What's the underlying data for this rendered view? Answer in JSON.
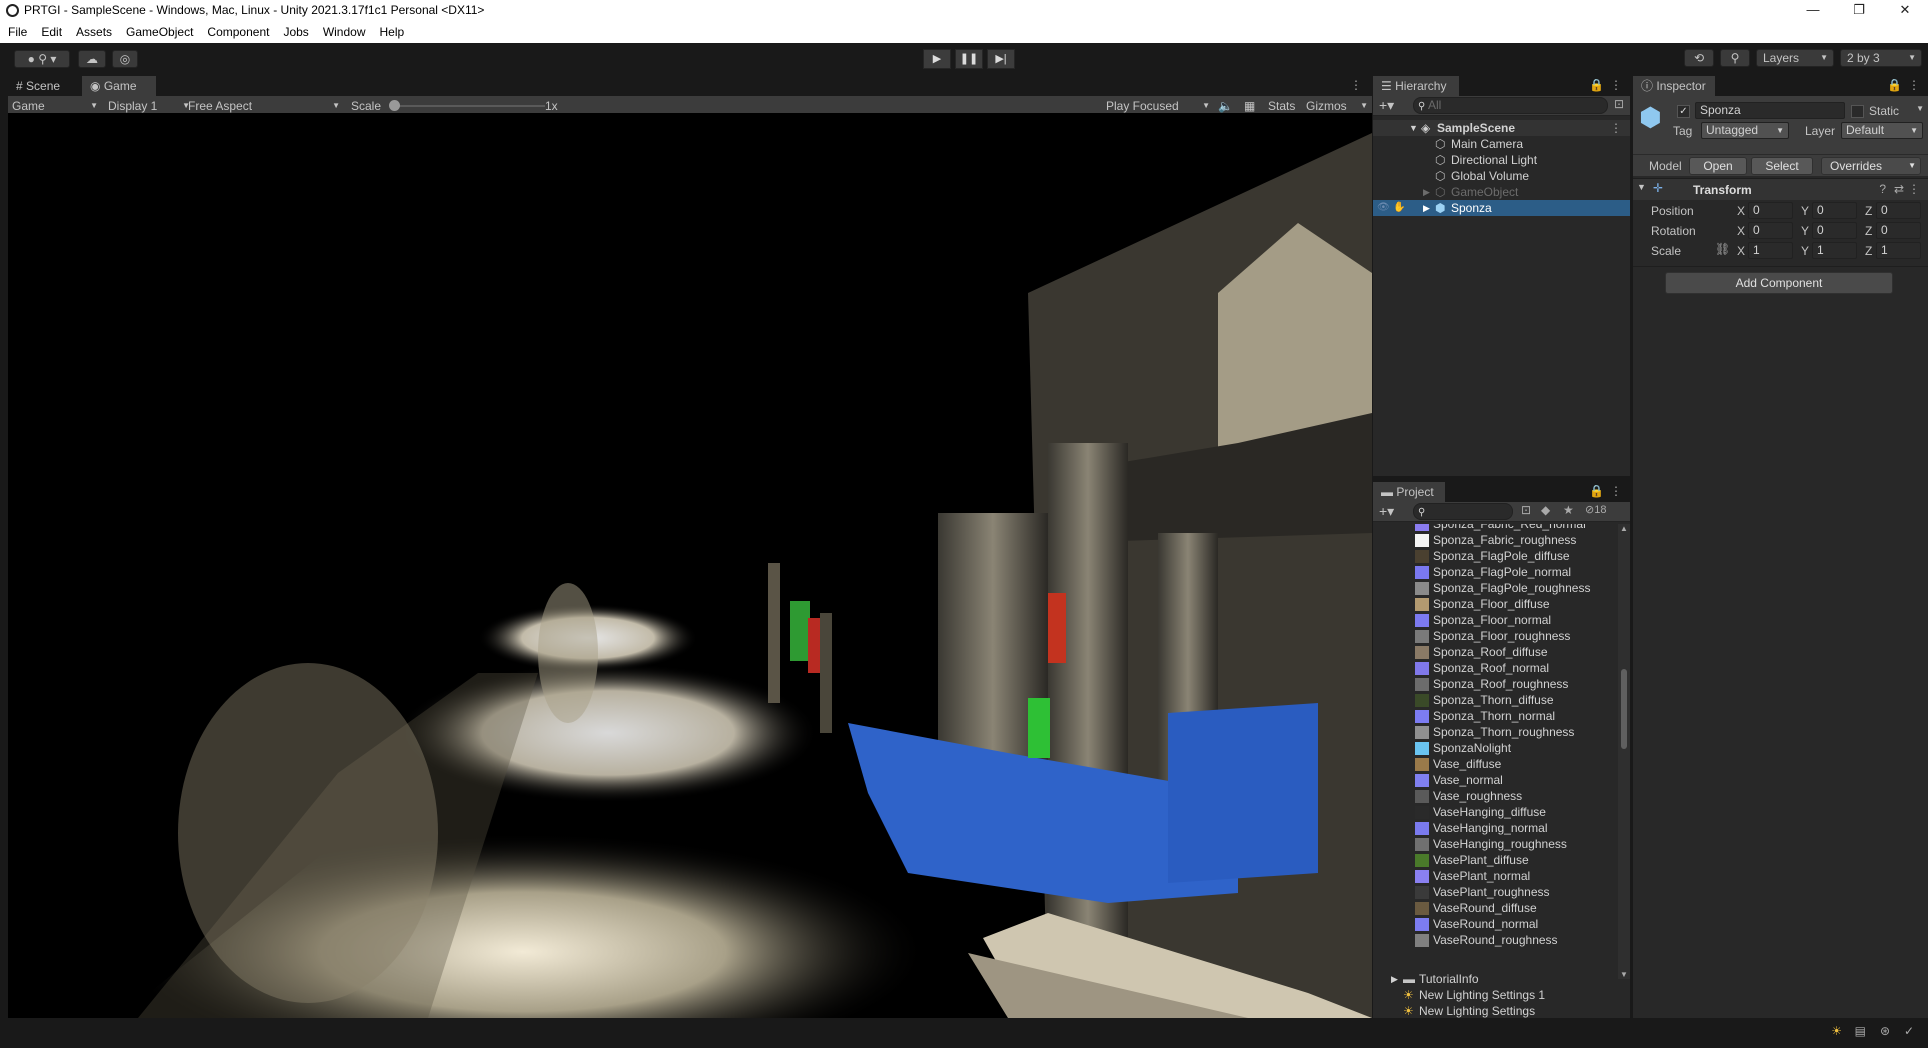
{
  "window": {
    "title": "PRTGI - SampleScene - Windows, Mac, Linux - Unity 2021.3.17f1c1 Personal <DX11>",
    "controls": [
      "—",
      "❐",
      "✕"
    ]
  },
  "menu": [
    "File",
    "Edit",
    "Assets",
    "GameObject",
    "Component",
    "Jobs",
    "Window",
    "Help"
  ],
  "toolbar": {
    "account_label": "",
    "layers_label": "Layers",
    "layout_label": "2 by 3"
  },
  "game_panel": {
    "tabs": [
      "Scene",
      "Game"
    ],
    "active_tab": "Game",
    "view_mode": "Game",
    "display": "Display 1",
    "aspect": "Free Aspect",
    "scale_label": "Scale",
    "scale_value": "1x",
    "play_mode": "Play Focused",
    "stats_label": "Stats",
    "gizmos_label": "Gizmos"
  },
  "hierarchy": {
    "tab_label": "Hierarchy",
    "search_placeholder": "All",
    "scene_name": "SampleScene",
    "items": [
      {
        "label": "Main Camera",
        "dim": false
      },
      {
        "label": "Directional Light",
        "dim": false
      },
      {
        "label": "Global Volume",
        "dim": false
      },
      {
        "label": "GameObject",
        "dim": true
      },
      {
        "label": "Sponza",
        "dim": false,
        "selected": true
      }
    ]
  },
  "project": {
    "tab_label": "Project",
    "hidden_count": "18",
    "items": [
      {
        "label": "Sponza_Fabric_Red_normal",
        "thumb": "#8a7cf0"
      },
      {
        "label": "Sponza_Fabric_roughness",
        "thumb": "#f4f4f4"
      },
      {
        "label": "Sponza_FlagPole_diffuse",
        "thumb": "#4a4030"
      },
      {
        "label": "Sponza_FlagPole_normal",
        "thumb": "#7a78f0"
      },
      {
        "label": "Sponza_FlagPole_roughness",
        "thumb": "#8a8a8a"
      },
      {
        "label": "Sponza_Floor_diffuse",
        "thumb": "#b39a70"
      },
      {
        "label": "Sponza_Floor_normal",
        "thumb": "#7c7af0"
      },
      {
        "label": "Sponza_Floor_roughness",
        "thumb": "#7a7a7a"
      },
      {
        "label": "Sponza_Roof_diffuse",
        "thumb": "#8a7a66"
      },
      {
        "label": "Sponza_Roof_normal",
        "thumb": "#8078ea"
      },
      {
        "label": "Sponza_Roof_roughness",
        "thumb": "#6c6c6c"
      },
      {
        "label": "Sponza_Thorn_diffuse",
        "thumb": "#3a4a28"
      },
      {
        "label": "Sponza_Thorn_normal",
        "thumb": "#7c7cf2"
      },
      {
        "label": "Sponza_Thorn_roughness",
        "thumb": "#909090"
      },
      {
        "label": "SponzaNolight",
        "thumb": "#6ac4f0"
      },
      {
        "label": "Vase_diffuse",
        "thumb": "#9a7a4a"
      },
      {
        "label": "Vase_normal",
        "thumb": "#8080f0"
      },
      {
        "label": "Vase_roughness",
        "thumb": "#5a5a5a"
      },
      {
        "label": "VaseHanging_diffuse",
        "thumb": "#2a2a2a"
      },
      {
        "label": "VaseHanging_normal",
        "thumb": "#7a7aee"
      },
      {
        "label": "VaseHanging_roughness",
        "thumb": "#707070"
      },
      {
        "label": "VasePlant_diffuse",
        "thumb": "#4a7a2a"
      },
      {
        "label": "VasePlant_normal",
        "thumb": "#8a80f0"
      },
      {
        "label": "VasePlant_roughness",
        "thumb": "#3a3a3a"
      },
      {
        "label": "VaseRound_diffuse",
        "thumb": "#6a5a40"
      },
      {
        "label": "VaseRound_normal",
        "thumb": "#7c7cf0"
      },
      {
        "label": "VaseRound_roughness",
        "thumb": "#808080"
      }
    ],
    "folder": "TutorialInfo",
    "lighting_items": [
      "New Lighting Settings 1",
      "New Lighting Settings"
    ]
  },
  "inspector": {
    "tab_label": "Inspector",
    "object_name": "Sponza",
    "static_label": "Static",
    "tag_label": "Tag",
    "tag_value": "Untagged",
    "layer_label": "Layer",
    "layer_value": "Default",
    "model_label": "Model",
    "open_button": "Open",
    "select_button": "Select",
    "overrides_label": "Overrides",
    "transform_title": "Transform",
    "position_label": "Position",
    "rotation_label": "Rotation",
    "scale_label": "Scale",
    "axes": [
      "X",
      "Y",
      "Z"
    ],
    "position": [
      "0",
      "0",
      "0"
    ],
    "rotation": [
      "0",
      "0",
      "0"
    ],
    "scale": [
      "1",
      "1",
      "1"
    ],
    "add_component": "Add Component"
  },
  "colors": {
    "accent_selected": "#2c5d87",
    "panel_bg": "#282828",
    "dark_bg": "#191919"
  }
}
